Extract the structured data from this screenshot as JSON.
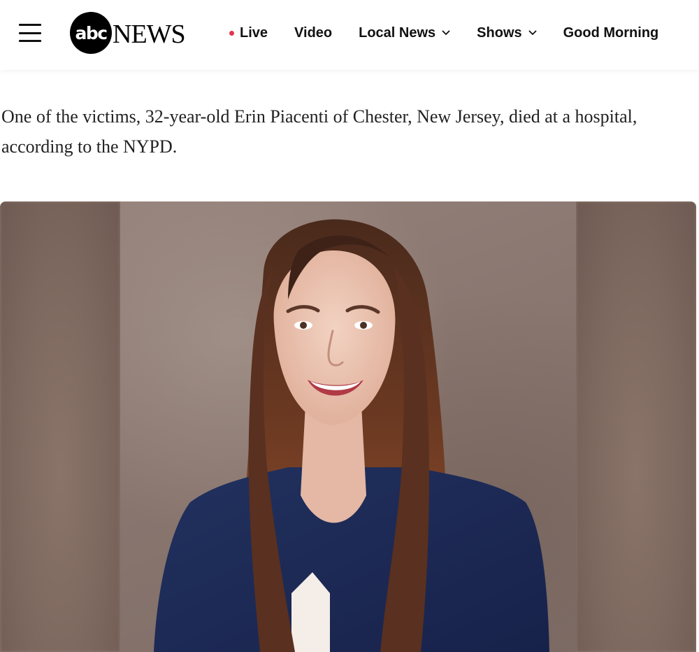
{
  "header": {
    "logo_mark": "abc",
    "logo_text": "NEWS",
    "nav": [
      {
        "label": "Live",
        "live_indicator": true
      },
      {
        "label": "Video"
      },
      {
        "label": "Local News",
        "dropdown": true
      },
      {
        "label": "Shows",
        "dropdown": true
      },
      {
        "label": "Good Morning"
      }
    ]
  },
  "article": {
    "paragraph": "One of the victims, 32-year-old Erin Piacenti of Chester, New Jersey, died at a hospital, according to the NYPD."
  },
  "icons": {
    "menu": "hamburger-menu-icon",
    "live": "live-dot-icon",
    "dropdown": "chevron-down-icon"
  },
  "colors": {
    "live_dot": "#e2364f",
    "logo_bg": "#000000",
    "photo_backdrop": "#8e7a70",
    "jacket": "#1f2d5c",
    "hair": "#6e3a22"
  }
}
